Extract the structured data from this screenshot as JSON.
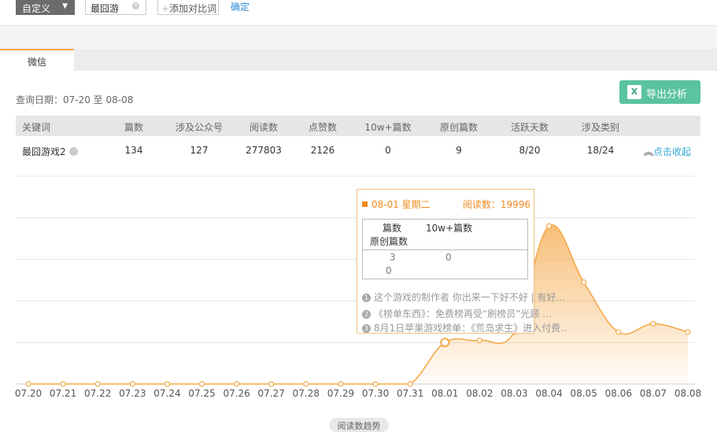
{
  "filters": {
    "range_select": "自定义",
    "keyword": "最囧游",
    "add_compare": "添加对比词",
    "confirm": "确定"
  },
  "tabs": [
    {
      "label": "微信",
      "active": true
    }
  ],
  "query_date": "查询日期：07-20 至 08-08",
  "export_label": "导出分析",
  "table": {
    "headers": [
      "关键词",
      "篇数",
      "涉及公众号",
      "阅读数",
      "点赞数",
      "10w+篇数",
      "原创篇数",
      "活跃天数",
      "涉及类别"
    ],
    "row": {
      "keyword": "最囧游戏2",
      "articles": "134",
      "accounts": "127",
      "reads": "277803",
      "likes": "2126",
      "w10": "0",
      "original": "9",
      "active_days": "8/20",
      "categories": "18/24",
      "action": "点击收起"
    }
  },
  "tooltip": {
    "date": "08-01 星期二",
    "reads": "阅读数：19996",
    "col1": "篇数",
    "col2": "10w+篇数",
    "col3": "原创篇数",
    "val1": "3",
    "val2": "0",
    "val3": "0",
    "news": [
      {
        "num": "1",
        "text": "这个游戏的制作者 你出来一下好不好 | 有好..."
      },
      {
        "num": "2",
        "text": "《榜单东西》：免费榜再受“刷榜员”光顾 ..."
      },
      {
        "num": "3",
        "text": "8月1日苹果游戏榜单：《荒岛求生》进入付费..."
      }
    ]
  },
  "chart_data": {
    "type": "area",
    "x": [
      "07.20",
      "07.21",
      "07.22",
      "07.23",
      "07.24",
      "07.25",
      "07.26",
      "07.27",
      "07.28",
      "07.29",
      "07.30",
      "07.31",
      "08.01",
      "08.02",
      "08.03",
      "08.04",
      "08.05",
      "08.06",
      "08.07",
      "08.08"
    ],
    "series": [
      {
        "values": [
          0,
          0,
          0,
          0,
          0,
          0,
          0,
          0,
          0,
          0,
          0,
          0,
          19996,
          21000,
          25000,
          76000,
          49000,
          25000,
          29000,
          25000
        ]
      }
    ],
    "ylim": [
      0,
      100000
    ],
    "gridlines": 5,
    "color": "#f5a94a",
    "highlight_index": 12
  },
  "chart_footer": "阅读数趋势"
}
